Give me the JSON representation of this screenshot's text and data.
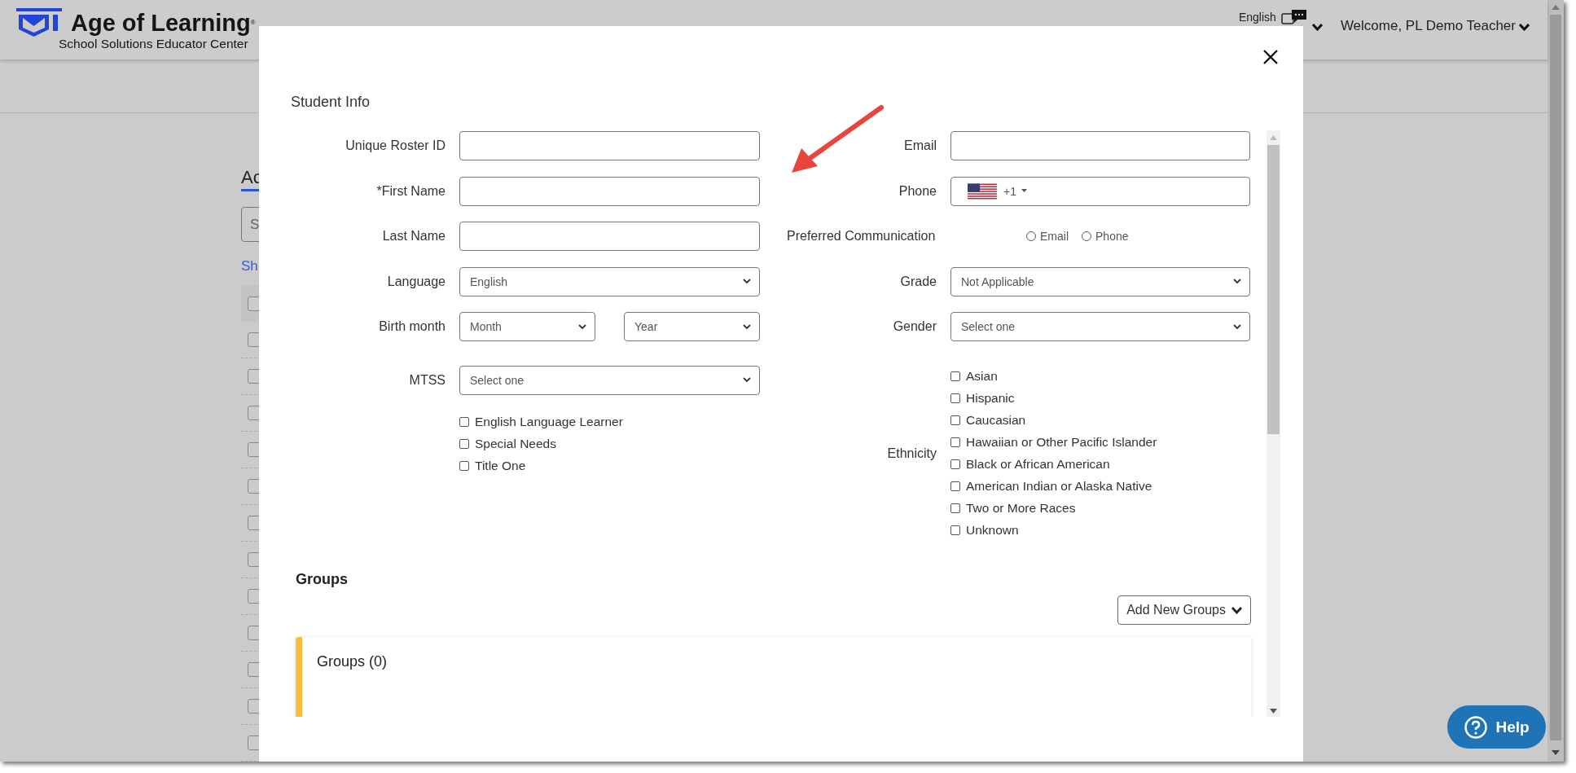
{
  "header": {
    "logo_title": "Age of Learning$^{®}$",
    "logo_subtitle": "School Solutions Educator Center",
    "language": "English",
    "welcome": "Welcome, PL Demo Teacher"
  },
  "background": {
    "heading": "Ac",
    "search_placeholder": "S",
    "link": "Sh",
    "rows": [
      {
        "kind": "header",
        "checked": false
      },
      {
        "kind": "row",
        "checked": false
      },
      {
        "kind": "row",
        "checked": false
      },
      {
        "kind": "row",
        "checked": false
      },
      {
        "kind": "row",
        "checked": false
      },
      {
        "kind": "row",
        "checked": false
      },
      {
        "kind": "row",
        "checked": false
      },
      {
        "kind": "row",
        "checked": false
      },
      {
        "kind": "row",
        "checked": false
      },
      {
        "kind": "row",
        "checked": false
      },
      {
        "kind": "row",
        "checked": false
      },
      {
        "kind": "row",
        "checked": false
      },
      {
        "kind": "row",
        "checked": false
      }
    ]
  },
  "modal": {
    "title": "Student Info",
    "left_fields": [
      {
        "label": "Unique Roster ID",
        "kind": "text"
      },
      {
        "label": "*First Name",
        "kind": "text"
      },
      {
        "label": "Last Name",
        "kind": "text"
      },
      {
        "label": "Language",
        "kind": "select",
        "value": "English"
      },
      {
        "label": "Birth month",
        "kind": "pair",
        "selects": [
          "Month",
          "Year"
        ]
      },
      {
        "label": "MTSS",
        "kind": "select",
        "value": "Select one"
      }
    ],
    "left_checkboxes": [
      {
        "label": "English Language Learner",
        "checked": false
      },
      {
        "label": "Special Needs",
        "checked": false
      },
      {
        "label": "Title One",
        "checked": false
      }
    ],
    "right_fields": [
      {
        "label": "Email",
        "kind": "text"
      },
      {
        "label": "Phone",
        "kind": "phone",
        "country_code": "+1"
      },
      {
        "label": "Preferred Communication",
        "kind": "radio",
        "options": [
          {
            "label": "Email",
            "selected": false
          },
          {
            "label": "Phone",
            "selected": false
          }
        ]
      },
      {
        "label": "Grade",
        "kind": "select",
        "value": "Not Applicable"
      },
      {
        "label": "Gender",
        "kind": "select",
        "value": "Select one"
      },
      {
        "label": "Ethnicity",
        "kind": "checklist",
        "options": [
          {
            "label": "Asian",
            "checked": false
          },
          {
            "label": "Hispanic",
            "checked": false
          },
          {
            "label": "Caucasian",
            "checked": false
          },
          {
            "label": "Hawaiian or Other Pacific Islander",
            "checked": false
          },
          {
            "label": "Black or African American",
            "checked": false
          },
          {
            "label": "American Indian or Alaska Native",
            "checked": false
          },
          {
            "label": "Two or More Races",
            "checked": false
          },
          {
            "label": "Unknown",
            "checked": false
          }
        ]
      }
    ],
    "groups": {
      "title": "Groups",
      "add_button": "Add New Groups",
      "card_title": "Groups (0)"
    }
  },
  "help_button": "Help"
}
